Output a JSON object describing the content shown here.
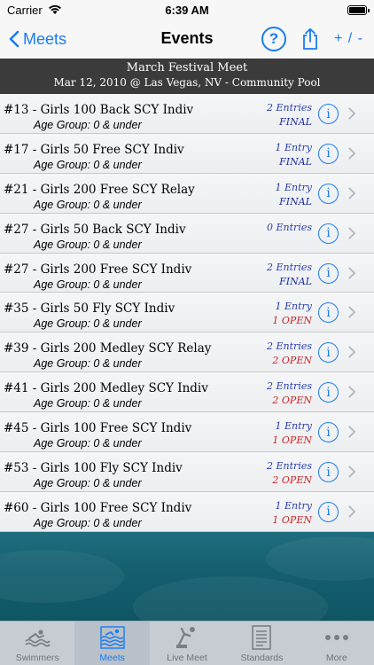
{
  "status_bar": {
    "carrier": "Carrier",
    "time": "6:39 AM"
  },
  "nav": {
    "back_label": "Meets",
    "title": "Events",
    "help_label": "?",
    "plus_minus_label": "+ / -"
  },
  "meet": {
    "name": "March Festival Meet",
    "details": "Mar 12, 2010 @ Las Vegas, NV - Community Pool"
  },
  "events": [
    {
      "title": "#13 - Girls 100 Back SCY Indiv",
      "age": "Age Group: 0 & under",
      "entries": "2 Entries",
      "status": "FINAL",
      "status_type": "final"
    },
    {
      "title": "#17 - Girls 50 Free SCY Indiv",
      "age": "Age Group: 0 & under",
      "entries": "1 Entry",
      "status": "FINAL",
      "status_type": "final"
    },
    {
      "title": "#21 - Girls 200 Free SCY Relay",
      "age": "Age Group: 0 & under",
      "entries": "1 Entry",
      "status": "FINAL",
      "status_type": "final"
    },
    {
      "title": "#27 - Girls 50 Back SCY Indiv",
      "age": "Age Group: 0 & under",
      "entries": "0 Entries",
      "status": "",
      "status_type": "final"
    },
    {
      "title": "#27 - Girls 200 Free SCY Indiv",
      "age": "Age Group: 0 & under",
      "entries": "2 Entries",
      "status": "FINAL",
      "status_type": "final"
    },
    {
      "title": "#35 - Girls 50 Fly SCY Indiv",
      "age": "Age Group: 0 & under",
      "entries": "1 Entry",
      "status": "1 OPEN",
      "status_type": "open"
    },
    {
      "title": "#39 - Girls 200 Medley SCY Relay",
      "age": "Age Group: 0 & under",
      "entries": "2 Entries",
      "status": "2 OPEN",
      "status_type": "open"
    },
    {
      "title": "#41 - Girls 200 Medley SCY Indiv",
      "age": "Age Group: 0 & under",
      "entries": "2 Entries",
      "status": "2 OPEN",
      "status_type": "open"
    },
    {
      "title": "#45 - Girls 100 Free SCY Indiv",
      "age": "Age Group: 0 & under",
      "entries": "1 Entry",
      "status": "1 OPEN",
      "status_type": "open"
    },
    {
      "title": "#53 - Girls 100 Fly SCY Indiv",
      "age": "Age Group: 0 & under",
      "entries": "2 Entries",
      "status": "2 OPEN",
      "status_type": "open"
    },
    {
      "title": "#60 - Girls 100 Free SCY Indiv",
      "age": "Age Group: 0 & under",
      "entries": "1 Entry",
      "status": "1 OPEN",
      "status_type": "open"
    }
  ],
  "tabs": [
    {
      "label": "Swimmers",
      "icon": "swimmers-icon",
      "active": false
    },
    {
      "label": "Meets",
      "icon": "meets-icon",
      "active": true
    },
    {
      "label": "Live Meet",
      "icon": "live-meet-icon",
      "active": false
    },
    {
      "label": "Standards",
      "icon": "standards-icon",
      "active": false
    },
    {
      "label": "More",
      "icon": "more-icon",
      "active": false
    }
  ],
  "colors": {
    "accent": "#1a7cf5",
    "final": "#1f2fa3",
    "open": "#c9262b",
    "header_bg": "#3b3b3b"
  }
}
